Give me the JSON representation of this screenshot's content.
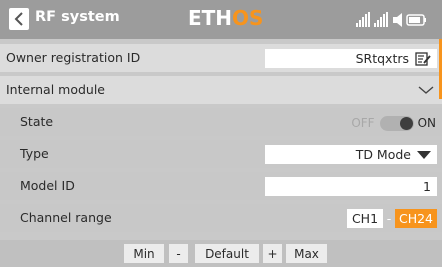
{
  "header": {
    "title": "RF system",
    "logo_main": "ETH",
    "logo_accent": "OS",
    "back_icon": "chevron-left-icon",
    "status_icons": [
      "signal-icon",
      "signal-icon",
      "volume-icon",
      "battery-icon"
    ]
  },
  "rows": {
    "owner": {
      "label": "Owner registration ID",
      "value": "SRtqxtrs",
      "icon": "edit-icon"
    },
    "internal": {
      "label": "Internal module",
      "icon": "chevron-down-icon"
    },
    "state": {
      "label": "State",
      "off": "OFF",
      "on": "ON",
      "value": "ON"
    },
    "type": {
      "label": "Type",
      "value": "TD Mode",
      "icon": "dropdown-arrow-icon"
    },
    "model_id": {
      "label": "Model ID",
      "value": "1"
    },
    "channel_range": {
      "label": "Channel range",
      "start": "CH1",
      "sep": "-",
      "end": "CH24"
    }
  },
  "footer": {
    "min": "Min",
    "minus": "-",
    "default": "Default",
    "plus": "+",
    "max": "Max"
  },
  "colors": {
    "accent": "#f7941d",
    "header": "#9c9c9c"
  }
}
